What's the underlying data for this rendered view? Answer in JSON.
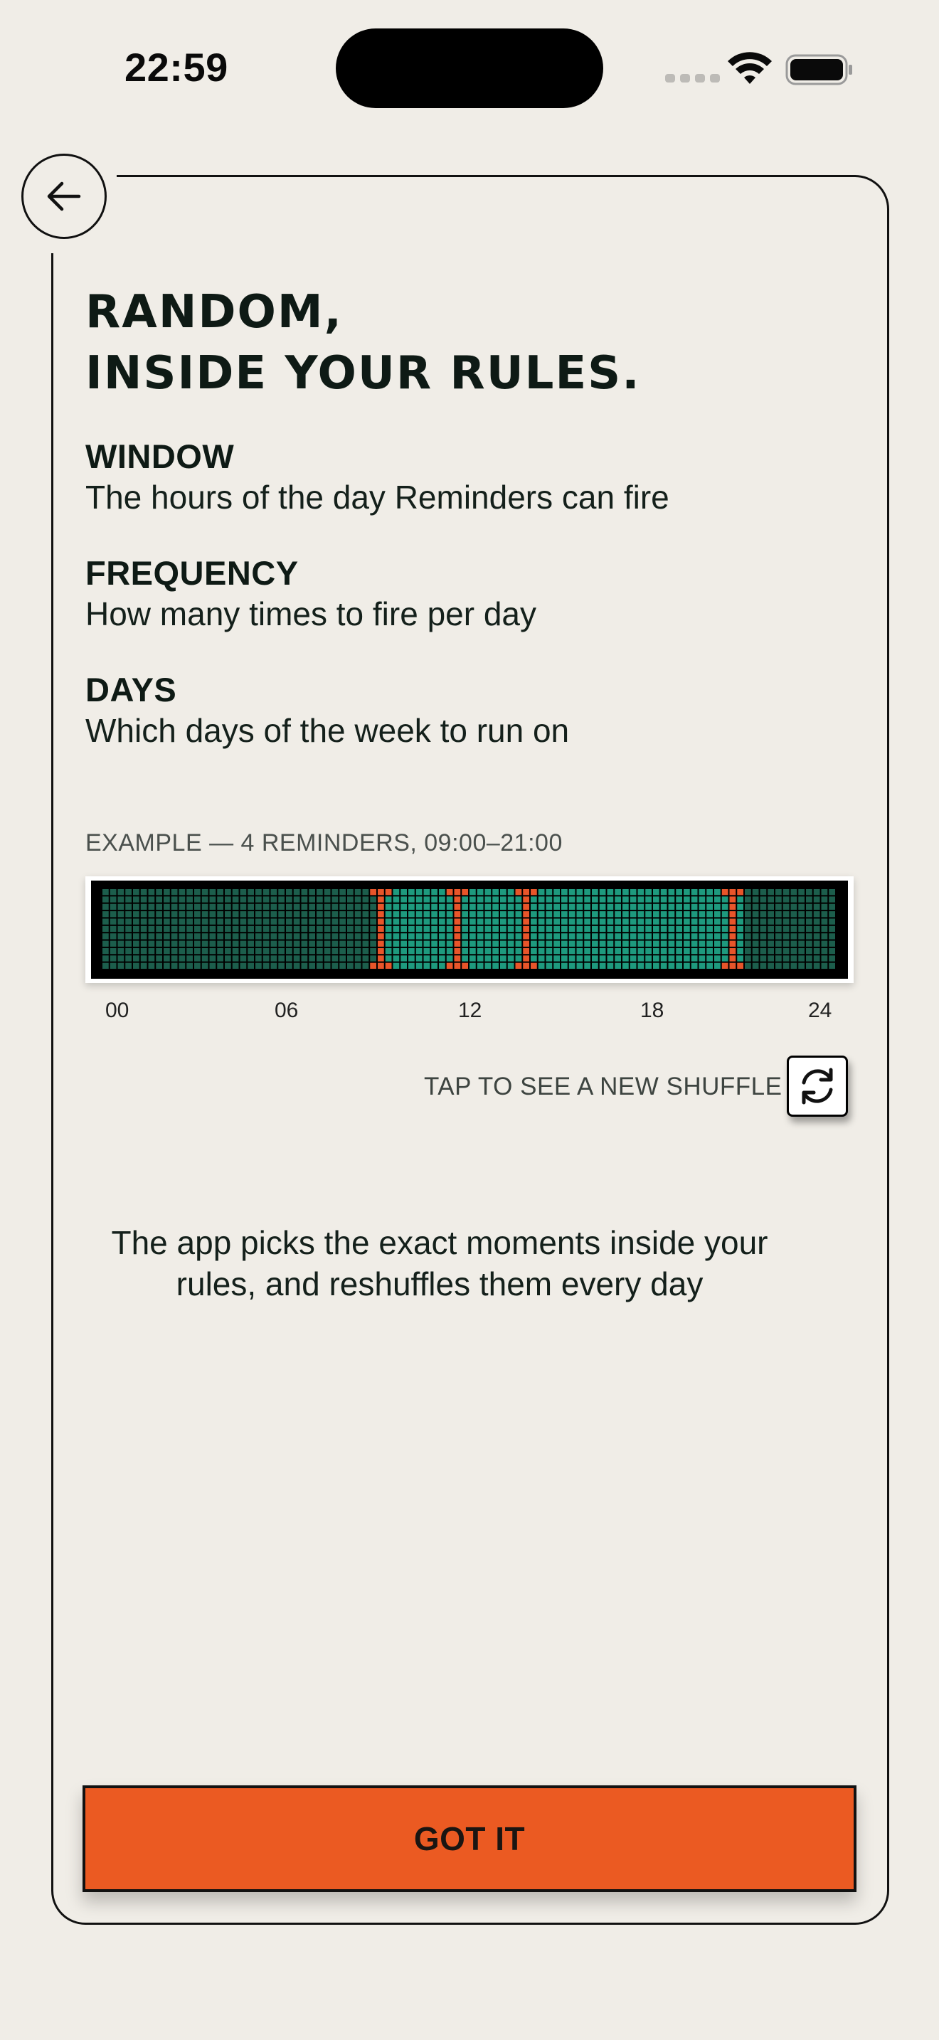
{
  "status_bar": {
    "time": "22:59"
  },
  "onboarding": {
    "title_line1": "RANDOM,",
    "title_line2": "INSIDE YOUR RULES.",
    "rules": [
      {
        "label": "WINDOW",
        "description": "The hours of the day Reminders can fire"
      },
      {
        "label": "FREQUENCY",
        "description": "How many times to fire per day"
      },
      {
        "label": "DAYS",
        "description": "Which days of the week to run on"
      }
    ],
    "example_label": "EXAMPLE — 4 REMINDERS, 09:00–21:00",
    "timeline": {
      "ticks": [
        "00",
        "06",
        "12",
        "18",
        "24"
      ],
      "window_start_hour": 9,
      "window_end_hour": 21,
      "reminder_hours": [
        9.15,
        11.55,
        13.8,
        20.5
      ],
      "colors": {
        "background": "#000000",
        "off": "#1C5E4C",
        "in_window": "#1E9A7E",
        "reminder": "#E8552A"
      }
    },
    "shuffle_label": "TAP TO SEE A NEW SHUFFLE",
    "shuffle_icon": "refresh-icon",
    "footer_text": "The app picks the exact moments inside your rules, and reshuffles them every day",
    "primary_button": "GOT IT",
    "back_icon": "arrow-left-icon",
    "accent_color": "#EB5A22"
  }
}
